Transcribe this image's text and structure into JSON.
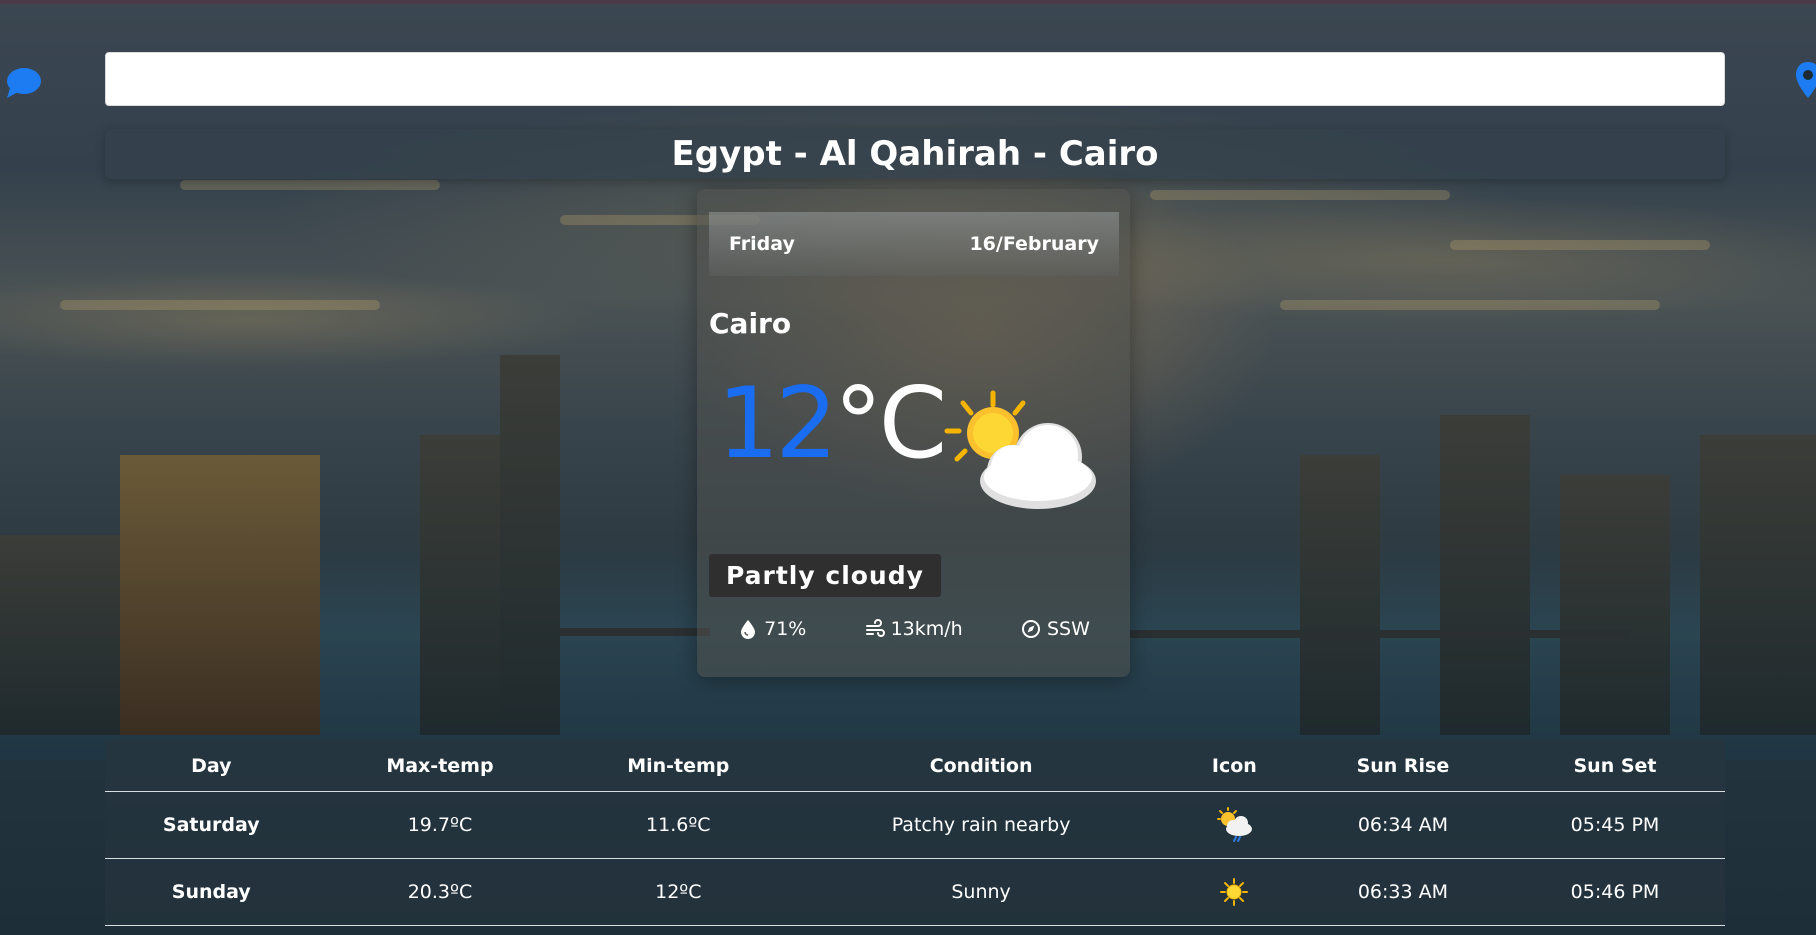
{
  "search": {
    "value": "",
    "placeholder": ""
  },
  "location": {
    "title": "Egypt - Al Qahirah - Cairo"
  },
  "current": {
    "day": "Friday",
    "date": "16/February",
    "city": "Cairo",
    "temp_value": "12",
    "temp_unit": "°C",
    "condition": "Partly cloudy",
    "condition_icon": "partly-cloudy-icon",
    "humidity": "71%",
    "wind_speed": "13km/h",
    "wind_direction": "SSW"
  },
  "forecast": {
    "headers": [
      "Day",
      "Max-temp",
      "Min-temp",
      "Condition",
      "Icon",
      "Sun Rise",
      "Sun Set"
    ],
    "rows": [
      {
        "day": "Saturday",
        "max": "19.7ºC",
        "min": "11.6ºC",
        "condition": "Patchy rain nearby",
        "icon": "patchy-rain-icon",
        "sunrise": "06:34 AM",
        "sunset": "05:45 PM"
      },
      {
        "day": "Sunday",
        "max": "20.3ºC",
        "min": "12ºC",
        "condition": "Sunny",
        "icon": "sunny-icon",
        "sunrise": "06:33 AM",
        "sunset": "05:46 PM"
      }
    ]
  },
  "colors": {
    "accent": "#1a6cf0",
    "icon_blue": "#1e7cf2"
  },
  "icons": {
    "left": "chat-icon",
    "right": "location-pin-icon",
    "humidity": "droplet-icon",
    "wind": "wind-icon",
    "direction": "compass-icon"
  }
}
